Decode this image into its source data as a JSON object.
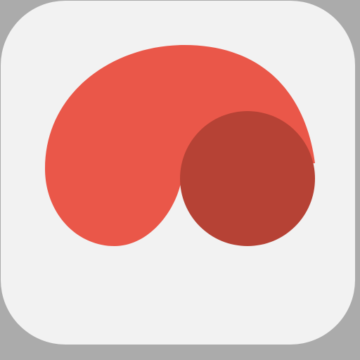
{
  "icon": {
    "name": "app-icon",
    "shape": "rounded-square",
    "colors": {
      "background": "#f2f2f2",
      "surround": "#ababab",
      "shell": "#ea5749",
      "circle": "#b64235"
    }
  }
}
